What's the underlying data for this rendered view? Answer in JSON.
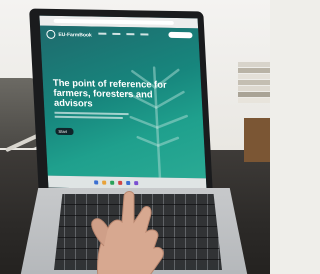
{
  "scene": "photo of a person typing on a laptop showing a website",
  "site": {
    "logo_text": "EU-FarmBook",
    "headline": "The point of reference for farmers, foresters and advisors",
    "button_label": "Start"
  },
  "colors": {
    "hero_teal": "#17867d",
    "hero_light": "#2aaa94",
    "laptop_silver": "#c7c9cb",
    "keyboard": "#2a2c2e"
  }
}
